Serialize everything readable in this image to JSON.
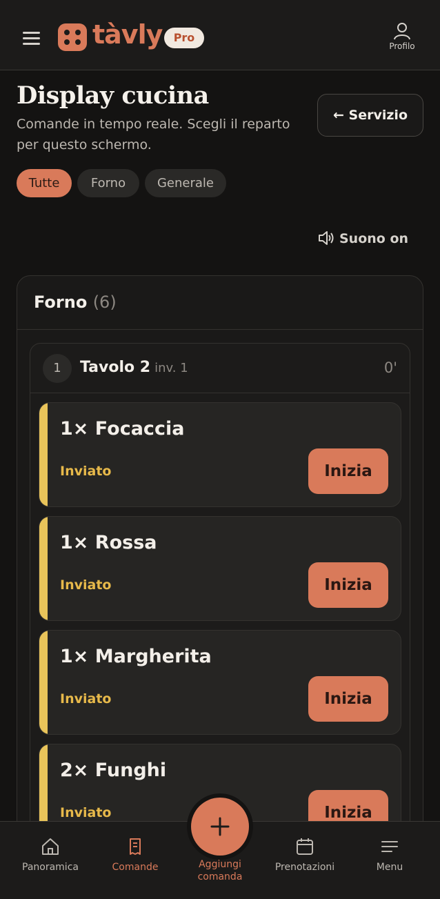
{
  "header": {
    "brand": "tàvly",
    "plan_badge": "Pro",
    "profile_label": "Profilo"
  },
  "page": {
    "title": "Display cucina",
    "subtitle": "Comande in tempo reale. Scegli il reparto per questo schermo.",
    "back_button": "← Servizio"
  },
  "filters": [
    {
      "label": "Tutte",
      "active": true
    },
    {
      "label": "Forno",
      "active": false
    },
    {
      "label": "Generale",
      "active": false
    }
  ],
  "sound": {
    "label": "Suono on"
  },
  "station": {
    "name": "Forno",
    "count": "(6)",
    "ticket": {
      "sequence": "1",
      "table": "Tavolo 2",
      "sent": "inv. 1",
      "elapsed": "0'",
      "items": [
        {
          "name": "1× Focaccia",
          "status": "Inviato",
          "action": "Inizia"
        },
        {
          "name": "1× Rossa",
          "status": "Inviato",
          "action": "Inizia"
        },
        {
          "name": "1× Margherita",
          "status": "Inviato",
          "action": "Inizia"
        },
        {
          "name": "2× Funghi",
          "status": "Inviato",
          "action": "Inizia"
        }
      ]
    }
  },
  "nav": {
    "overview": "Panoramica",
    "orders": "Comande",
    "add_line1": "Aggiungi",
    "add_line2": "comanda",
    "bookings": "Prenotazioni",
    "menu": "Menu"
  },
  "colors": {
    "accent": "#d97a5a",
    "status_stripe": "#e9c45a",
    "status_text": "#e7b94a",
    "background": "#141312"
  },
  "icons": [
    "menu-icon",
    "logo-icon",
    "user-icon",
    "arrow-left-icon",
    "speaker-icon",
    "home-icon",
    "receipt-icon",
    "plus-icon",
    "calendar-icon",
    "menu-lines-icon"
  ]
}
